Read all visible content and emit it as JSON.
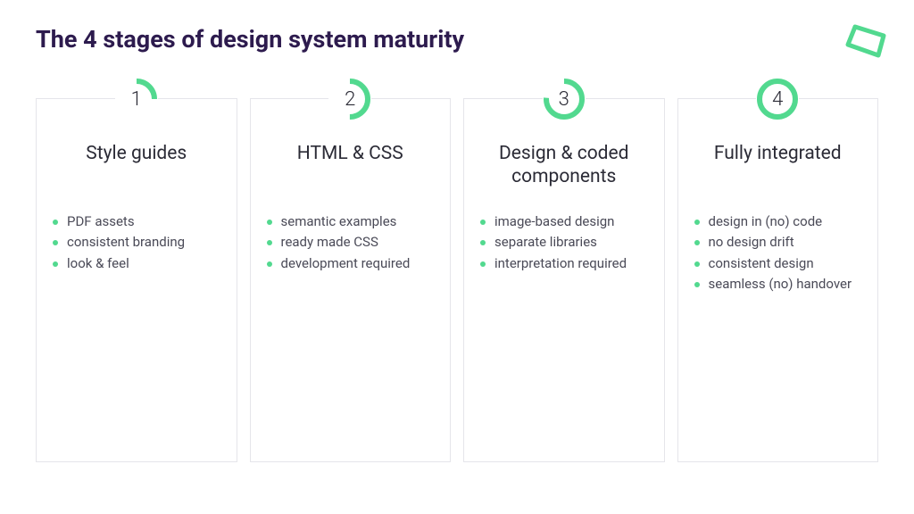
{
  "title": "The 4 stages of design system maturity",
  "accent": "#52d98f",
  "cards": [
    {
      "num": "1",
      "arc_pct": 25,
      "heading": "Style guides",
      "bullets": [
        "PDF assets",
        "consistent branding",
        "look & feel"
      ]
    },
    {
      "num": "2",
      "arc_pct": 50,
      "heading": "HTML & CSS",
      "bullets": [
        "semantic examples",
        "ready made CSS",
        "development required"
      ]
    },
    {
      "num": "3",
      "arc_pct": 76,
      "heading": "Design & coded components",
      "bullets": [
        "image-based design",
        "separate libraries",
        "interpretation required"
      ]
    },
    {
      "num": "4",
      "arc_pct": 100,
      "heading": "Fully integrated",
      "bullets": [
        "design in (no) code",
        "no design drift",
        "consistent design",
        "seamless (no) handover"
      ]
    }
  ]
}
